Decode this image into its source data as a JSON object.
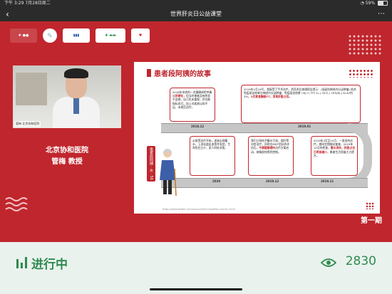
{
  "status_bar": {
    "time": "下午 3:29",
    "date": "7月28日周二",
    "battery": "59%"
  },
  "nav": {
    "title": "世界肝炎日公益课堂"
  },
  "logos": [
    "logo-chinese-foundation",
    "logo-magnifier",
    "logo-hospital",
    "logo-liver-association",
    "logo-public-welfare"
  ],
  "speaker": {
    "hospital": "北京协和医院",
    "name": "管梅 教授",
    "video_caption": "管梅 北京协和医院"
  },
  "slide": {
    "title": "患者段阿姨的故事",
    "vertical_tag": "患者段阿姨 · 女 · 56岁",
    "cards": [
      {
        "text": "2018年年底的一次健康体检中确诊",
        "hl": "肝硬化",
        "tail": "，但当时患者没有明显不适感，自己也未重视，肝功能指标尚可，加上对疾病认知不足，未规范治疗。"
      },
      {
        "text": "2019年1月16号，我接受了手术治疗，然而术后病理报告提示：(低级别神经内分泌肿瘤) 结合免疫组化结果为神经内分泌肿瘤：免疫组化结果 CK(+) TTF-1(-) CK7(-) CK5/6(-) Ki-67约3%。",
        "hl": "",
        "tail": "3月复查胸部CT，发现肝脏占位。"
      },
      {
        "text": "从接受治疗开始，逐渐出现腹水，上消化道出血等并发症，生命危在旦夕，",
        "hl": "",
        "tail": "家人四处求医。"
      },
      {
        "text": "我们立刻给予腹水引流、保肝等对症治疗，同时在MDT团队的评估后，",
        "hl": "牛磺酸腺嘌呤",
        "tail": "治疗方案启动，病情很快得到控制。"
      },
      {
        "text": "2019年4月至10月，一直坚持治疗，期间定期随访复查，2019年12月的检查，",
        "hl": "腹水消失，肝脏占位已明显缩小",
        "tail": "，患者生活质量大大提升。"
      }
    ],
    "dates": [
      "2018.12",
      "2019.01",
      "2020",
      "2019.12",
      "2019.11"
    ],
    "footer": "https://www.bilibili.com/source/liver-hepatitis-course-2020"
  },
  "episode": "第一期",
  "live": {
    "status": "进行中",
    "viewers": "2830"
  },
  "colors": {
    "brand_red": "#c0262d",
    "live_green": "#2f8a4e"
  }
}
